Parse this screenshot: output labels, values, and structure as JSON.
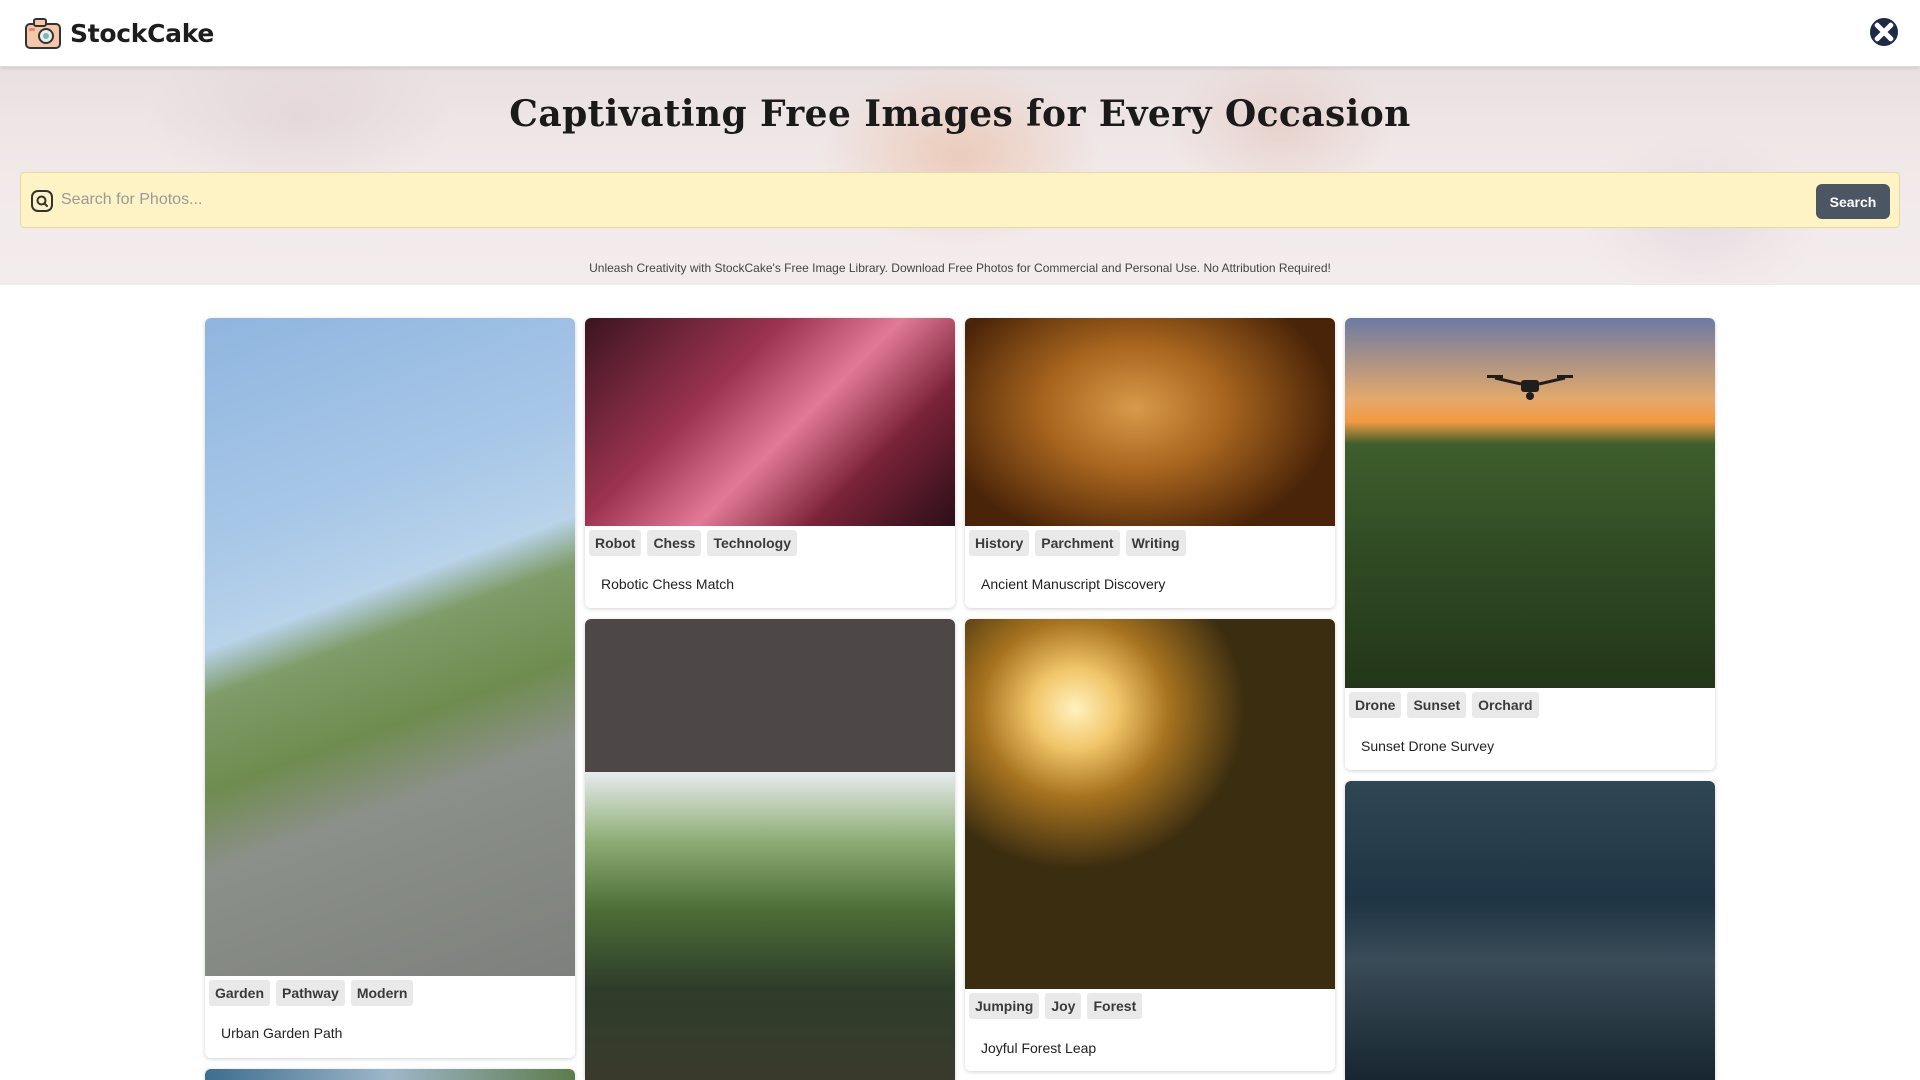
{
  "app": {
    "name": "StockCake"
  },
  "hero": {
    "title": "Captivating Free Images for Every Occasion",
    "search_placeholder": "Search for Photos...",
    "search_button": "Search",
    "tagline": "Unleash Creativity with StockCake's Free Image Library. Download Free Photos for Commercial and Personal Use. No Attribution Required!"
  },
  "colors": {
    "search_bg": "#fdf3c4",
    "search_button": "#4c5663",
    "tag_bg": "#e9e9e9"
  },
  "cards": [
    {
      "title": "Urban Garden Path",
      "tags": [
        "Garden",
        "Pathway",
        "Modern"
      ]
    },
    {
      "title": "Robotic Chess Match",
      "tags": [
        "Robot",
        "Chess",
        "Technology"
      ]
    },
    {
      "title": "Ancient Manuscript Discovery",
      "tags": [
        "History",
        "Parchment",
        "Writing"
      ]
    },
    {
      "title": "Sunset Drone Survey",
      "tags": [
        "Drone",
        "Sunset",
        "Orchard"
      ]
    },
    {
      "title": "Joyful Forest Leap",
      "tags": [
        "Jumping",
        "Joy",
        "Forest"
      ]
    }
  ]
}
